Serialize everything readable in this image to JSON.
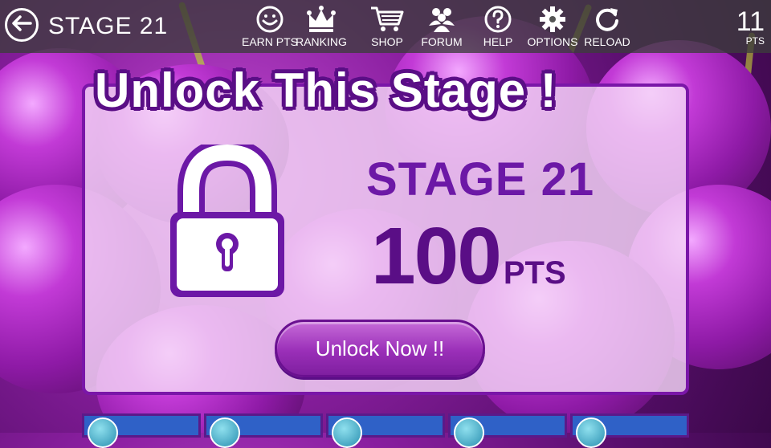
{
  "topbar": {
    "back_icon": "arrow-left-circle-icon",
    "stage_title": "STAGE 21",
    "menu": [
      {
        "label": "EARN PTS",
        "icon": "smiley-icon"
      },
      {
        "label": "RANKING",
        "icon": "crown-icon"
      },
      {
        "label": "SHOP",
        "icon": "cart-icon"
      },
      {
        "label": "FORUM",
        "icon": "people-icon"
      },
      {
        "label": "HELP",
        "icon": "question-icon"
      },
      {
        "label": "OPTIONS",
        "icon": "gear-icon"
      },
      {
        "label": "RELOAD",
        "icon": "reload-icon"
      }
    ],
    "points": "11",
    "points_unit": "PTS"
  },
  "dialog": {
    "title": "Unlock This Stage !",
    "stage_name": "STAGE 21",
    "cost_value": "100",
    "cost_unit": "PTS",
    "button_label": "Unlock Now !!",
    "lock_icon": "padlock-icon"
  },
  "colors": {
    "accent_purple": "#7a16a8",
    "dark_purple": "#5a0e86",
    "button_purple": "#9a2fb8",
    "tile_blue": "#2f61c7"
  }
}
